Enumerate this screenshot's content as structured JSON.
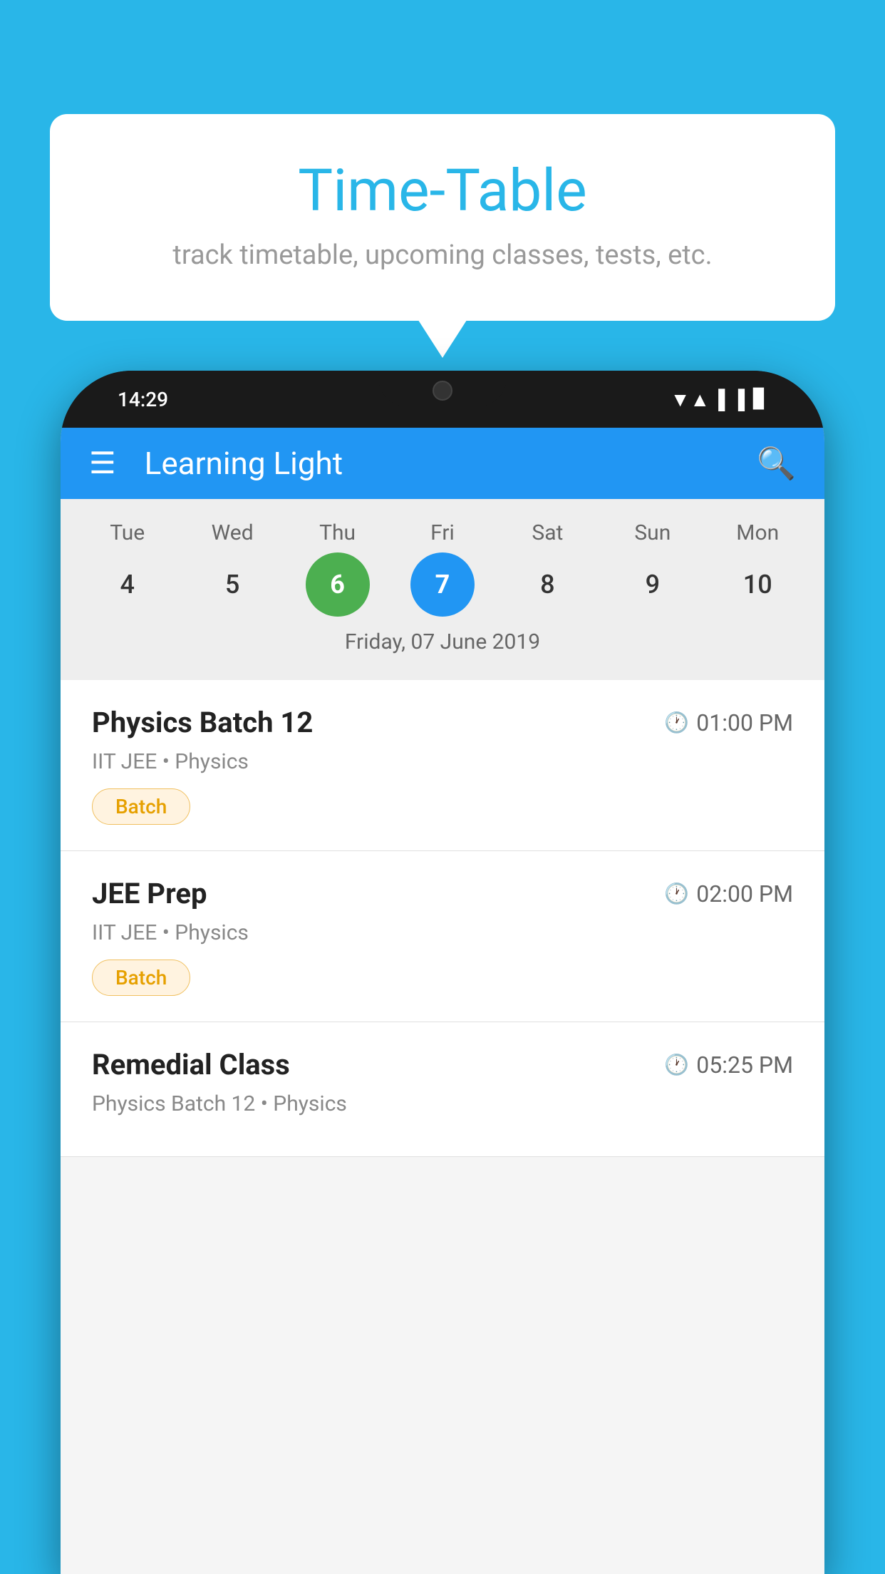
{
  "background_color": "#29b6e8",
  "tooltip": {
    "title": "Time-Table",
    "subtitle": "track timetable, upcoming classes, tests, etc."
  },
  "phone": {
    "status_time": "14:29",
    "app_title": "Learning Light",
    "calendar": {
      "days": [
        {
          "short": "Tue",
          "num": "4"
        },
        {
          "short": "Wed",
          "num": "5"
        },
        {
          "short": "Thu",
          "num": "6",
          "state": "today"
        },
        {
          "short": "Fri",
          "num": "7",
          "state": "selected"
        },
        {
          "short": "Sat",
          "num": "8"
        },
        {
          "short": "Sun",
          "num": "9"
        },
        {
          "short": "Mon",
          "num": "10"
        }
      ],
      "selected_date_label": "Friday, 07 June 2019"
    },
    "classes": [
      {
        "name": "Physics Batch 12",
        "time": "01:00 PM",
        "course": "IIT JEE",
        "subject": "Physics",
        "badge": "Batch"
      },
      {
        "name": "JEE Prep",
        "time": "02:00 PM",
        "course": "IIT JEE",
        "subject": "Physics",
        "badge": "Batch"
      },
      {
        "name": "Remedial Class",
        "time": "05:25 PM",
        "course": "Physics Batch 12",
        "subject": "Physics",
        "badge": ""
      }
    ]
  },
  "icons": {
    "hamburger": "≡",
    "search": "🔍",
    "clock": "🕐"
  }
}
